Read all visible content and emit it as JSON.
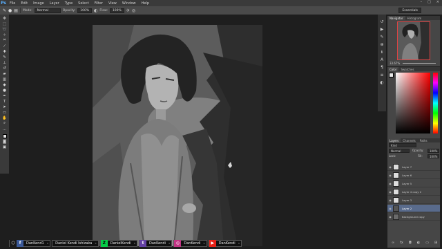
{
  "app": {
    "logo": "Ps"
  },
  "menu": [
    "File",
    "Edit",
    "Image",
    "Layer",
    "Type",
    "Select",
    "Filter",
    "View",
    "Window",
    "Help"
  ],
  "window_controls": [
    "–",
    "□",
    "×"
  ],
  "options": {
    "mode_label": "Mode:",
    "mode_value": "Normal",
    "opacity_label": "Opacity:",
    "opacity_value": "100%",
    "flow_label": "Flow:",
    "flow_value": "100%",
    "workspace": "Essentials"
  },
  "panels": {
    "navigator_tabs": [
      "Navigator",
      "Histogram"
    ],
    "navigator_zoom": "33.67%",
    "color_tabs": [
      "Color",
      "Swatches"
    ],
    "layers_tabs": [
      "Layers",
      "Channels",
      "Paths"
    ],
    "kind_label": "Kind",
    "blend_mode": "Normal",
    "opacity_label": "Opacity:",
    "opacity_value": "100%",
    "lock_label": "Lock:",
    "fill_label": "Fill:",
    "fill_value": "100%"
  },
  "layers": [
    {
      "name": "Layer 7"
    },
    {
      "name": "Layer 6"
    },
    {
      "name": "Layer 5"
    },
    {
      "name": "Layer 4 copy 2"
    },
    {
      "name": "Layer 3"
    },
    {
      "name": "Layer 2"
    },
    {
      "name": "Background copy"
    }
  ],
  "social": [
    {
      "icon": "facebook-icon",
      "glyph": "f",
      "color": "#3b5998",
      "text": "DanKend1"
    },
    {
      "icon": "deviantart-icon",
      "glyph": "",
      "color": "#111111",
      "text": "Daniel Kendi Ishizaka"
    },
    {
      "icon": "deviantart-icon",
      "glyph": "Z",
      "color": "#05cc47",
      "text": "DanielKendi"
    },
    {
      "icon": "twitch-icon",
      "glyph": "t",
      "color": "#6441a5",
      "text": "DanKendi"
    },
    {
      "icon": "instagram-icon",
      "glyph": "◎",
      "color": "#c13584",
      "text": "DanKendi"
    },
    {
      "icon": "youtube-icon",
      "glyph": "▶",
      "color": "#e62117",
      "text": "DanKendi"
    }
  ],
  "colors": {
    "menubar": "#3a3a3a",
    "workspace_bg": "#1e1e1e",
    "selected_layer": "#596b8c",
    "navigator_frame": "#dd4444"
  }
}
